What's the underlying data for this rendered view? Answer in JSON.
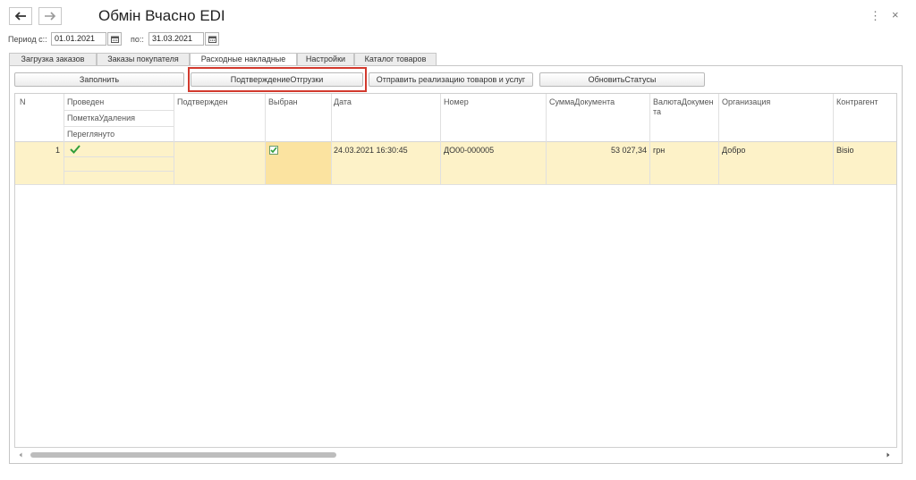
{
  "window": {
    "title": "Обмін Вчасно EDI",
    "more_icon": "⋮",
    "close_icon": "×"
  },
  "period": {
    "from_label": "Период с::",
    "from_value": "01.01.2021",
    "to_label": "по::",
    "to_value": "31.03.2021"
  },
  "tabs": [
    {
      "label": "Загрузка заказов"
    },
    {
      "label": "Заказы покупателя"
    },
    {
      "label": "Расходные накладные"
    },
    {
      "label": "Настройки"
    },
    {
      "label": "Каталог товаров"
    }
  ],
  "toolbar": {
    "fill_label": "Заполнить",
    "confirm_label": "ПодтверждениеОтгрузки",
    "send_label": "Отправить реализацию товаров и услуг",
    "refresh_label": "ОбновитьСтатусы"
  },
  "table": {
    "headers": {
      "n": "N",
      "posted": "Проведен",
      "deletion_mark": "ПометкаУдаления",
      "viewed": "Переглянуто",
      "confirmed": "Подтвержден",
      "selected": "Выбран",
      "date": "Дата",
      "number": "Номер",
      "amount": "СуммаДокумента",
      "currency": "ВалютаДокумента",
      "organization": "Организация",
      "counterparty": "Контрагент"
    },
    "rows": [
      {
        "n": "1",
        "posted": true,
        "selected": true,
        "date": "24.03.2021 16:30:45",
        "number": "ДО00-000005",
        "amount": "53 027,34",
        "currency": "грн",
        "organization": "Добро",
        "counterparty": "Bisio"
      }
    ]
  },
  "colors": {
    "accent": "#d23a2e",
    "selected_row": "#fdf2c8",
    "selected_cell": "#fbe3a0",
    "check": "#2f9e3a"
  },
  "scroll": {
    "horizontal_thumb_fraction": 0.36
  }
}
